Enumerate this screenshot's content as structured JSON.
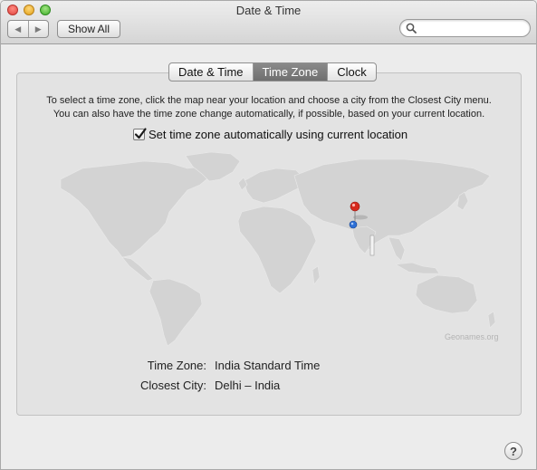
{
  "window": {
    "title": "Date & Time"
  },
  "toolbar": {
    "back_icon": "◀",
    "forward_icon": "▶",
    "show_all_label": "Show All",
    "search": {
      "value": "",
      "placeholder": ""
    }
  },
  "tabs": [
    {
      "label": "Date & Time",
      "selected": false
    },
    {
      "label": "Time Zone",
      "selected": true
    },
    {
      "label": "Clock",
      "selected": false
    }
  ],
  "timezone": {
    "instructions_line1": "To select a time zone, click the map near your location and choose a city from the Closest City menu.",
    "instructions_line2": "You can also have the time zone change automatically, if possible, based on your current location.",
    "auto_checkbox_label": "Set time zone automatically using current location",
    "auto_checked": true,
    "map_attribution": "Geonames.org",
    "time_zone_label": "Time Zone:",
    "time_zone_value": "India Standard Time",
    "closest_city_label": "Closest City:",
    "closest_city_value": "Delhi – India"
  },
  "colors": {
    "selected_tab": "#7c7c7c",
    "pin_red": "#d62a1e",
    "pin_blue": "#2c6fd6",
    "land": "#cfcfcf",
    "panel_bg": "#e3e3e3"
  },
  "help_label": "?"
}
